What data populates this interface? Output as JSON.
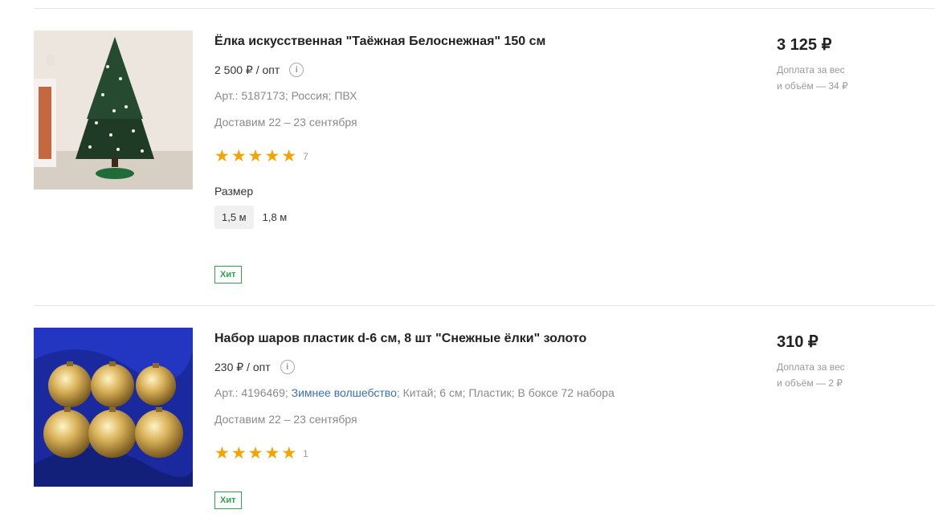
{
  "products": [
    {
      "title": "Ёлка искусственная \"Таёжная Белоснежная\" 150 см",
      "opt_price": "2 500 ₽ / опт",
      "meta": "Арт.: 5187173; Россия; ПВХ",
      "delivery": "Доставим 22 – 23 сентября",
      "rating_stars": 5,
      "rating_count": "7",
      "size_label": "Размер",
      "sizes": [
        "1,5 м",
        "1,8 м"
      ],
      "selected_size": "1,5 м",
      "badge": "Хит",
      "price": "3 125 ₽",
      "surcharge_line1": "Доплата за вес",
      "surcharge_line2": "и объём — 34 ₽"
    },
    {
      "title": "Набор шаров пластик d-6 см, 8 шт \"Снежные ёлки\" золото",
      "opt_price": "230 ₽ / опт",
      "meta_prefix": "Арт.: 4196469;",
      "meta_link": "Зимнее волшебство",
      "meta_suffix": "; Китай; 6 см; Пластик; В боксе 72 набора",
      "delivery": "Доставим 22 – 23 сентября",
      "rating_stars": 5,
      "rating_count": "1",
      "badge": "Хит",
      "price": "310 ₽",
      "surcharge_line1": "Доплата за вес",
      "surcharge_line2": "и объём — 2 ₽"
    }
  ],
  "colors": {
    "star": "#f5a300",
    "badge": "#2ea44f",
    "link": "#3b6fb6"
  }
}
